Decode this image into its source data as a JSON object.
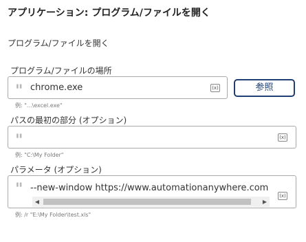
{
  "header": {
    "title": "アプリケーション: プログラム/ファイルを開く"
  },
  "description": "プログラム/ファイルを開く",
  "program_field": {
    "label": "プログラム/ファイルの場所",
    "value": "chrome.exe",
    "hint": "例: \"...\\excel.exe\"",
    "variable_icon": "(x)",
    "browse_label": "参照"
  },
  "start_in_field": {
    "label": "パスの最初の部分 (オプション)",
    "value": "",
    "hint": "例: \"C:\\My Folder\"",
    "variable_icon": "(x)"
  },
  "params_field": {
    "label": "パラメータ (オプション)",
    "value": "--new-window https://www.automationanywhere.com",
    "hint": "例: /r \"E:\\My Folder\\test.xls\"",
    "variable_icon": "(x)"
  },
  "icons": {
    "quote": "quote-icon",
    "variable": "variable-insert-icon",
    "scroll_left": "scroll-left-arrow-icon",
    "scroll_right": "scroll-right-arrow-icon"
  },
  "colors": {
    "accent": "#1f3f72",
    "border": "#a8a8a8",
    "hint": "#777777"
  }
}
